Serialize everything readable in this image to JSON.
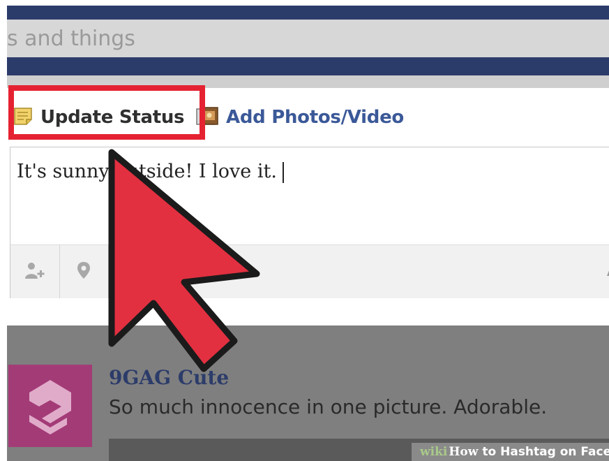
{
  "search": {
    "text": "s and things"
  },
  "composer": {
    "tabs": [
      {
        "label": "Update Status",
        "icon": "note-icon"
      },
      {
        "label": "Add Photos/Video",
        "icon": "camera-icon"
      }
    ],
    "status_text": "It's sunny outside! I love it."
  },
  "feed": {
    "page_name": "9GAG Cute",
    "post_text": "So much innocence in one picture. Adorable."
  },
  "watermark": {
    "brand": "wiki",
    "how": "How",
    "title": "to Hashtag on Facebook"
  },
  "colors": {
    "facebook_blue": "#3b5998",
    "highlight_red": "#e52231",
    "avatar_magenta": "#a33b77"
  }
}
